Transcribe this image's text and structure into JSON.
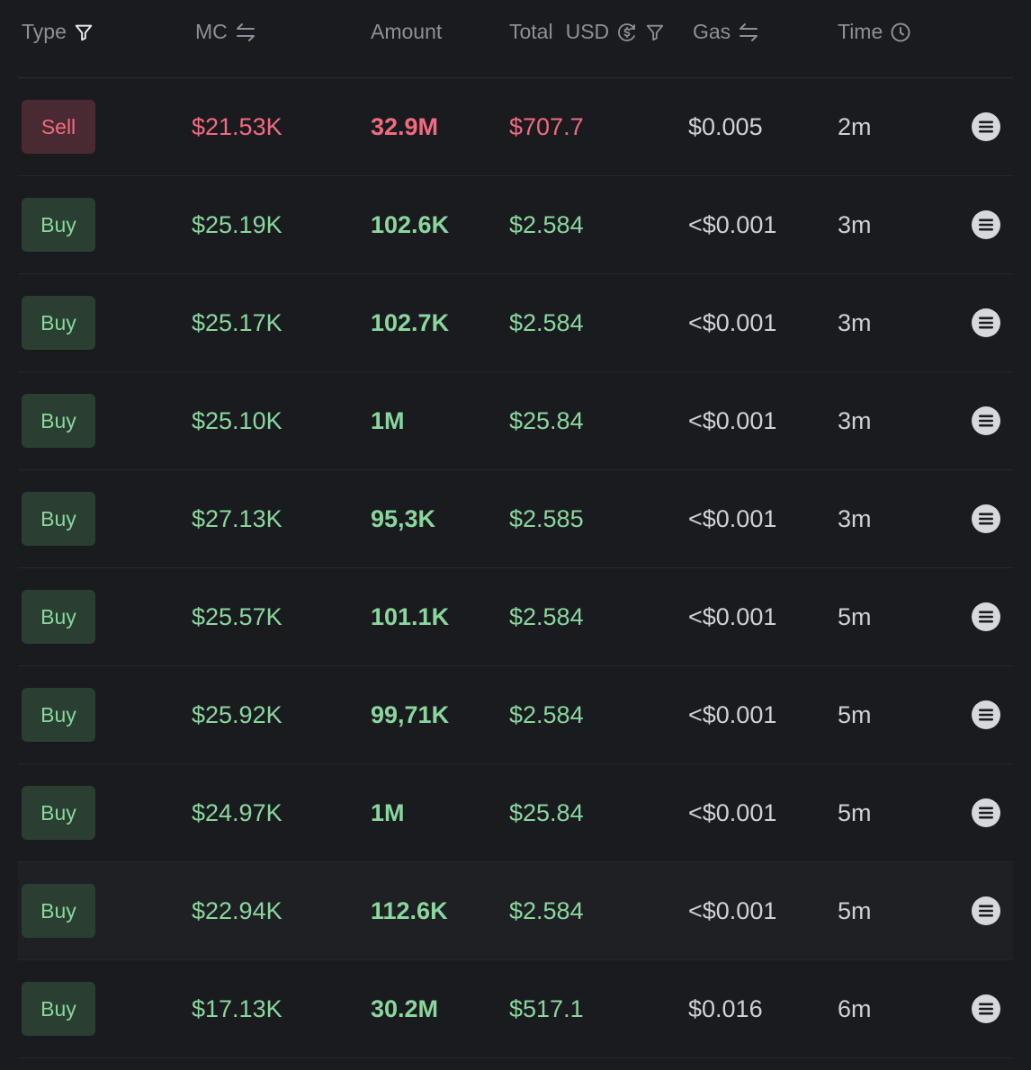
{
  "header": {
    "type_label": "Type",
    "mc_label": "MC",
    "amount_label": "Amount",
    "total_label": "Total",
    "usd_label": "USD",
    "gas_label": "Gas",
    "time_label": "Time",
    "icons": {
      "type": "filter-icon",
      "mc": "swap-icon",
      "usd": "currency-toggle-icon",
      "usd_filter": "filter-icon",
      "gas": "swap-icon",
      "time": "clock-icon"
    }
  },
  "colors": {
    "buy": "#8ad79e",
    "sell": "#f26b80",
    "buy_badge_bg": "#2a3f31",
    "sell_badge_bg": "#4a2a32",
    "background": "#1a1b1f"
  },
  "chain_icon": "solana-icon",
  "rows": [
    {
      "type": "Sell",
      "side": "sell",
      "mc": "$21.53K",
      "amount": "32.9M",
      "total": "$707.7",
      "gas": "$0.005",
      "time": "2m"
    },
    {
      "type": "Buy",
      "side": "buy",
      "mc": "$25.19K",
      "amount": "102.6K",
      "total": "$2.584",
      "gas": "<$0.001",
      "time": "3m"
    },
    {
      "type": "Buy",
      "side": "buy",
      "mc": "$25.17K",
      "amount": "102.7K",
      "total": "$2.584",
      "gas": "<$0.001",
      "time": "3m"
    },
    {
      "type": "Buy",
      "side": "buy",
      "mc": "$25.10K",
      "amount": "1M",
      "total": "$25.84",
      "gas": "<$0.001",
      "time": "3m"
    },
    {
      "type": "Buy",
      "side": "buy",
      "mc": "$27.13K",
      "amount": "95,3K",
      "total": "$2.585",
      "gas": "<$0.001",
      "time": "3m"
    },
    {
      "type": "Buy",
      "side": "buy",
      "mc": "$25.57K",
      "amount": "101.1K",
      "total": "$2.584",
      "gas": "<$0.001",
      "time": "5m"
    },
    {
      "type": "Buy",
      "side": "buy",
      "mc": "$25.92K",
      "amount": "99,71K",
      "total": "$2.584",
      "gas": "<$0.001",
      "time": "5m"
    },
    {
      "type": "Buy",
      "side": "buy",
      "mc": "$24.97K",
      "amount": "1M",
      "total": "$25.84",
      "gas": "<$0.001",
      "time": "5m"
    },
    {
      "type": "Buy",
      "side": "buy",
      "mc": "$22.94K",
      "amount": "112.6K",
      "total": "$2.584",
      "gas": "<$0.001",
      "time": "5m"
    },
    {
      "type": "Buy",
      "side": "buy",
      "mc": "$17.13K",
      "amount": "30.2M",
      "total": "$517.1",
      "gas": "$0.016",
      "time": "6m"
    }
  ]
}
